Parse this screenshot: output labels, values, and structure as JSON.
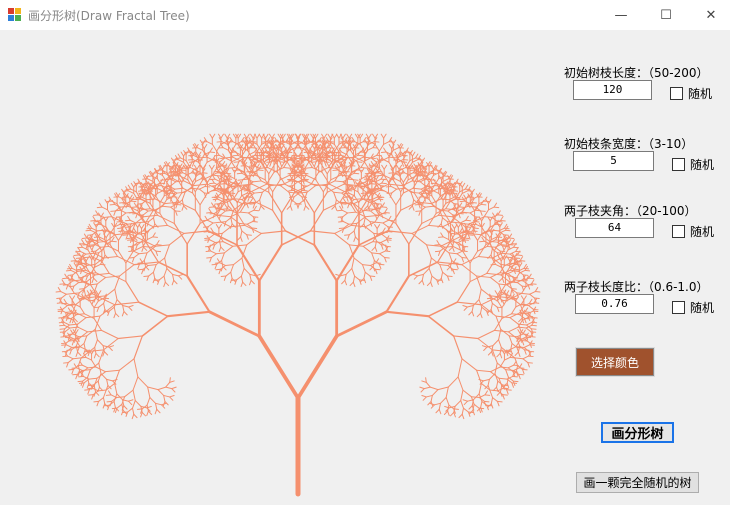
{
  "window": {
    "title": "画分形树(Draw Fractal Tree)",
    "controls": {
      "minimize": "—",
      "maximize": "☐",
      "close": "✕"
    }
  },
  "params": [
    {
      "label": "初始树枝长度：（50-200）",
      "value": "120",
      "random_label": "随机",
      "random_checked": false
    },
    {
      "label": "初始枝条宽度：（3-10）",
      "value": "5",
      "random_label": "随机",
      "random_checked": false
    },
    {
      "label": "两子枝夹角：（20-100）",
      "value": "64",
      "random_label": "随机",
      "random_checked": false
    },
    {
      "label": "两子枝长度比：（0.6-1.0）",
      "value": "0.76",
      "random_label": "随机",
      "random_checked": false
    }
  ],
  "buttons": {
    "color": "选择颜色",
    "draw": "画分形树",
    "random_tree": "画一颗完全随机的树"
  },
  "colors": {
    "tree": "#f5906e",
    "color_button": "#a0522d",
    "focus": "#1a73e8"
  }
}
